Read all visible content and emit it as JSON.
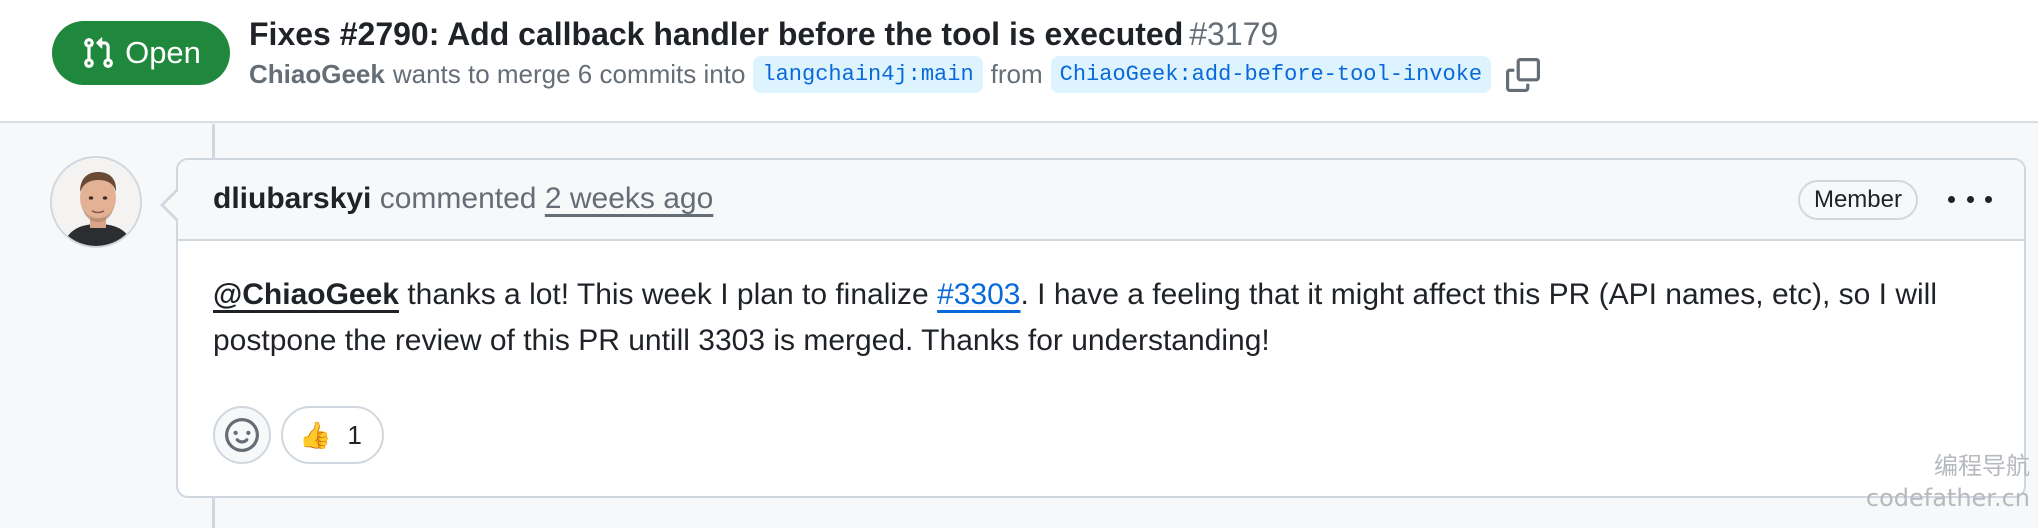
{
  "pr": {
    "state": "Open",
    "title": "Fixes #2790: Add callback handler before the tool is executed",
    "number": "#3179",
    "author": "ChiaoGeek",
    "merge_text": "wants to merge 6 commits into",
    "base_branch": "langchain4j:main",
    "from_text": "from",
    "head_branch": "ChiaoGeek:add-before-tool-invoke"
  },
  "comment": {
    "author": "dliubarskyi",
    "action": "commented",
    "time": "2 weeks ago",
    "role": "Member",
    "mention": "@ChiaoGeek",
    "text_before_link": " thanks a lot! This week I plan to finalize ",
    "link": "#3303",
    "text_after_link": ". I have a feeling that it might affect this PR (API names, etc), so I will postpone the review of this PR untill 3303 is merged. Thanks for understanding!",
    "reactions": [
      {
        "emoji": "👍",
        "count": "1"
      }
    ]
  },
  "watermark": {
    "line1": "编程导航",
    "line2": "codefather.cn"
  },
  "colors": {
    "open_green": "#1f883d",
    "link_blue": "#0969da",
    "branch_bg": "#ddf4ff"
  },
  "icons": [
    "git-pull-request-icon",
    "copy-icon",
    "smiley-icon",
    "kebab-icon",
    "avatar"
  ]
}
